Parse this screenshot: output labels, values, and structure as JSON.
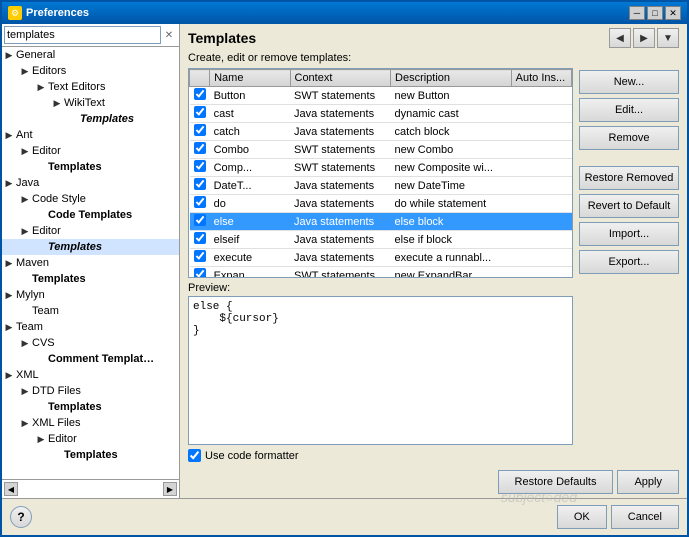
{
  "window": {
    "title": "Preferences",
    "title_icon": "⚙",
    "controls": [
      "─",
      "□",
      "✕"
    ]
  },
  "search": {
    "value": "templates",
    "placeholder": "templates"
  },
  "tree": [
    {
      "label": "General",
      "indent": 0,
      "toggle": "▶",
      "bold": false
    },
    {
      "label": "Editors",
      "indent": 1,
      "toggle": "▶",
      "bold": false
    },
    {
      "label": "Text Editors",
      "indent": 2,
      "toggle": "▶",
      "bold": false
    },
    {
      "label": "WikiText",
      "indent": 3,
      "toggle": "▶",
      "bold": false
    },
    {
      "label": "Templates",
      "indent": 4,
      "toggle": "",
      "bold": true,
      "italic": true
    },
    {
      "label": "Ant",
      "indent": 0,
      "toggle": "▶",
      "bold": false
    },
    {
      "label": "Editor",
      "indent": 1,
      "toggle": "▶",
      "bold": false
    },
    {
      "label": "Templates",
      "indent": 2,
      "toggle": "",
      "bold": true,
      "italic": false
    },
    {
      "label": "Java",
      "indent": 0,
      "toggle": "▶",
      "bold": false
    },
    {
      "label": "Code Style",
      "indent": 1,
      "toggle": "▶",
      "bold": false
    },
    {
      "label": "Code Templates",
      "indent": 2,
      "toggle": "",
      "bold": true,
      "italic": false
    },
    {
      "label": "Editor",
      "indent": 1,
      "toggle": "▶",
      "bold": false
    },
    {
      "label": "Templates",
      "indent": 2,
      "toggle": "",
      "bold": true,
      "italic": true,
      "selected": true
    },
    {
      "label": "Maven",
      "indent": 0,
      "toggle": "▶",
      "bold": false
    },
    {
      "label": "Templates",
      "indent": 1,
      "toggle": "",
      "bold": true,
      "italic": false
    },
    {
      "label": "Mylyn",
      "indent": 0,
      "toggle": "▶",
      "bold": false
    },
    {
      "label": "Team",
      "indent": 1,
      "toggle": "",
      "bold": false
    },
    {
      "label": "Team",
      "indent": 0,
      "toggle": "▶",
      "bold": false
    },
    {
      "label": "CVS",
      "indent": 1,
      "toggle": "▶",
      "bold": false
    },
    {
      "label": "Comment Templat…",
      "indent": 2,
      "toggle": "",
      "bold": true,
      "italic": false
    },
    {
      "label": "XML",
      "indent": 0,
      "toggle": "▶",
      "bold": false
    },
    {
      "label": "DTD Files",
      "indent": 1,
      "toggle": "▶",
      "bold": false
    },
    {
      "label": "Templates",
      "indent": 2,
      "toggle": "",
      "bold": true,
      "italic": false
    },
    {
      "label": "XML Files",
      "indent": 1,
      "toggle": "▶",
      "bold": false
    },
    {
      "label": "Editor",
      "indent": 2,
      "toggle": "▶",
      "bold": false
    },
    {
      "label": "Templates",
      "indent": 3,
      "toggle": "",
      "bold": true,
      "italic": false
    }
  ],
  "right": {
    "title": "Templates",
    "create_label": "Create, edit or remove templates:",
    "nav_buttons": [
      "◀",
      "▶",
      "▼"
    ]
  },
  "table": {
    "columns": [
      "Name",
      "Context",
      "Description",
      "Auto Ins..."
    ],
    "rows": [
      {
        "checked": true,
        "name": "Button",
        "context": "SWT statements",
        "description": "new Button",
        "auto": "",
        "selected": false
      },
      {
        "checked": true,
        "name": "cast",
        "context": "Java statements",
        "description": "dynamic cast",
        "auto": "",
        "selected": false
      },
      {
        "checked": true,
        "name": "catch",
        "context": "Java statements",
        "description": "catch block",
        "auto": "",
        "selected": false
      },
      {
        "checked": true,
        "name": "Combo",
        "context": "SWT statements",
        "description": "new Combo",
        "auto": "",
        "selected": false
      },
      {
        "checked": true,
        "name": "Comp...",
        "context": "SWT statements",
        "description": "new Composite wi...",
        "auto": "",
        "selected": false
      },
      {
        "checked": true,
        "name": "DateT...",
        "context": "Java statements",
        "description": "new DateTime",
        "auto": "",
        "selected": false
      },
      {
        "checked": true,
        "name": "do",
        "context": "Java statements",
        "description": "do while statement",
        "auto": "",
        "selected": false
      },
      {
        "checked": true,
        "name": "else",
        "context": "Java statements",
        "description": "else block",
        "auto": "",
        "selected": true
      },
      {
        "checked": true,
        "name": "elseif",
        "context": "Java statements",
        "description": "else if block",
        "auto": "",
        "selected": false
      },
      {
        "checked": true,
        "name": "execute",
        "context": "Java statements",
        "description": "execute a runnabl...",
        "auto": "",
        "selected": false
      },
      {
        "checked": true,
        "name": "Expan...",
        "context": "SWT statements",
        "description": "new ExpandBar",
        "auto": "",
        "selected": false
      }
    ]
  },
  "preview": {
    "label": "Preview:",
    "content": "else {\n    ${cursor}\n}"
  },
  "formatter": {
    "label": "Use code formatter",
    "checked": true
  },
  "side_buttons": [
    {
      "label": "New...",
      "disabled": false
    },
    {
      "label": "Edit...",
      "disabled": false
    },
    {
      "label": "Remove",
      "disabled": false
    },
    {
      "label": "Restore Removed",
      "disabled": false
    },
    {
      "label": "Revert to Default",
      "disabled": false
    },
    {
      "label": "Import...",
      "disabled": false
    },
    {
      "label": "Export...",
      "disabled": false
    }
  ],
  "bottom_buttons": [
    {
      "label": "Restore Defaults"
    },
    {
      "label": "Apply"
    }
  ],
  "dialog_buttons": [
    {
      "label": "OK"
    },
    {
      "label": "Cancel"
    }
  ],
  "watermark": "subject○ded"
}
